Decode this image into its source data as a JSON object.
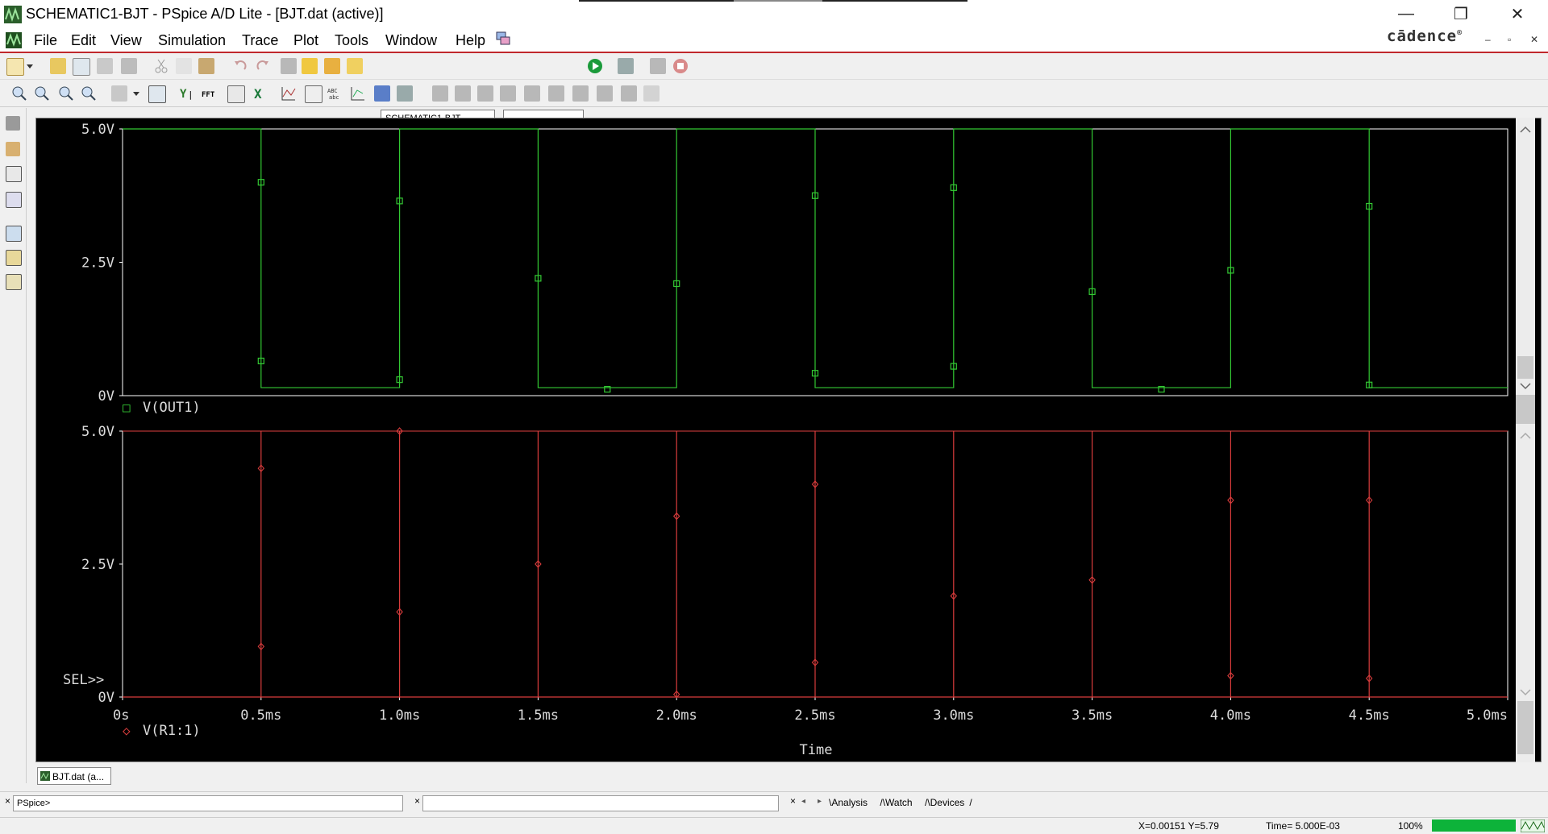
{
  "window": {
    "title": "SCHEMATIC1-BJT - PSpice A/D Lite - [BJT.dat (active)]",
    "controls": {
      "minimize": "—",
      "restore": "❐",
      "close": "✕"
    }
  },
  "menu": {
    "items": [
      "File",
      "Edit",
      "View",
      "Simulation",
      "Trace",
      "Plot",
      "Tools",
      "Window",
      "Help"
    ],
    "brand": "cādence",
    "brand_mark": "®",
    "mdi_controls": {
      "minimize": "–",
      "restore": "▫",
      "close": "✕"
    }
  },
  "toolbar": {
    "profile_value": "SCHEMATIC1-BJT",
    "second_combo_value": ""
  },
  "plot": {
    "upper": {
      "y_ticks": [
        "5.0V",
        "2.5V",
        "0V"
      ],
      "legend_marker": "□",
      "trace_label": "V(OUT1)",
      "color": "#33c933"
    },
    "lower": {
      "y_ticks": [
        "5.0V",
        "2.5V",
        "0V"
      ],
      "legend_marker": "◇",
      "trace_label": "V(R1:1)",
      "color": "#d93c3c",
      "sel_marker": "SEL>>"
    },
    "x_ticks": [
      "0s",
      "0.5ms",
      "1.0ms",
      "1.5ms",
      "2.0ms",
      "2.5ms",
      "3.0ms",
      "3.5ms",
      "4.0ms",
      "4.5ms",
      "5.0ms"
    ],
    "x_label": "Time",
    "background": "#000000",
    "grid_color": "#ffffff"
  },
  "chart_data": [
    {
      "type": "line",
      "series": [
        {
          "name": "V(OUT1)",
          "color": "#33c933"
        }
      ],
      "x": [
        0,
        0.5,
        0.5,
        1.0,
        1.0,
        1.5,
        1.5,
        2.0,
        2.0,
        2.5,
        2.5,
        3.0,
        3.0,
        3.5,
        3.5,
        4.0,
        4.0,
        4.5,
        4.5,
        5.0
      ],
      "values": [
        5.0,
        5.0,
        0.15,
        0.15,
        5.0,
        5.0,
        0.15,
        0.15,
        5.0,
        5.0,
        0.15,
        0.15,
        5.0,
        5.0,
        0.15,
        0.15,
        5.0,
        5.0,
        0.15,
        0.15
      ],
      "x_unit": "ms",
      "ylim": [
        0,
        5.0
      ],
      "xlim": [
        0,
        5.0
      ],
      "yticks": [
        "5.0V",
        "2.5V",
        "0V"
      ],
      "xlabel": "Time",
      "marker_points": [
        [
          0.5,
          4.0
        ],
        [
          0.5,
          0.65
        ],
        [
          1.0,
          3.65
        ],
        [
          1.0,
          0.3
        ],
        [
          1.5,
          2.2
        ],
        [
          1.75,
          0.12
        ],
        [
          2.0,
          2.1
        ],
        [
          2.5,
          3.75
        ],
        [
          2.5,
          0.42
        ],
        [
          3.0,
          3.9
        ],
        [
          3.0,
          0.55
        ],
        [
          3.5,
          1.95
        ],
        [
          3.75,
          0.12
        ],
        [
          4.0,
          2.35
        ],
        [
          4.5,
          3.55
        ],
        [
          4.5,
          0.2
        ]
      ]
    },
    {
      "type": "line",
      "series": [
        {
          "name": "V(R1:1)",
          "color": "#d93c3c"
        }
      ],
      "x": [
        0,
        0.5,
        0.5,
        0.5,
        1.0,
        1.0,
        1.0,
        1.5,
        1.5,
        1.5,
        2.0,
        2.0,
        2.0,
        2.5,
        2.5,
        2.5,
        3.0,
        3.0,
        3.0,
        3.5,
        3.5,
        3.5,
        4.0,
        4.0,
        4.0,
        4.5,
        4.5,
        4.5,
        5.0
      ],
      "values": [
        0,
        0,
        5.0,
        0,
        0,
        5.0,
        0,
        0,
        5.0,
        0,
        0,
        5.0,
        0,
        0,
        5.0,
        0,
        0,
        5.0,
        0,
        0,
        5.0,
        0,
        0,
        5.0,
        0,
        0,
        5.0,
        0,
        0
      ],
      "x_unit": "ms",
      "ylim": [
        0,
        5.0
      ],
      "xlim": [
        0,
        5.0
      ],
      "yticks": [
        "5.0V",
        "2.5V",
        "0V"
      ],
      "xlabel": "Time",
      "marker_points": [
        [
          0.5,
          4.3
        ],
        [
          0.5,
          0.95
        ],
        [
          1.0,
          5.0
        ],
        [
          1.0,
          1.6
        ],
        [
          1.5,
          2.5
        ],
        [
          2.0,
          3.4
        ],
        [
          2.0,
          0.05
        ],
        [
          2.5,
          4.0
        ],
        [
          2.5,
          0.65
        ],
        [
          3.0,
          1.9
        ],
        [
          3.5,
          2.2
        ],
        [
          4.0,
          3.7
        ],
        [
          4.0,
          0.4
        ],
        [
          4.5,
          3.7
        ],
        [
          4.5,
          0.35
        ]
      ]
    }
  ],
  "document_tab": {
    "label": "BJT.dat (a..."
  },
  "bottom": {
    "command_prompt": "PSpice>",
    "close_glyph": "×",
    "panel_tabs": [
      "Analysis",
      "Watch",
      "Devices"
    ]
  },
  "status": {
    "coords": "X=0.00151  Y=5.79",
    "time": "Time= 5.000E-03",
    "progress_label": "100%",
    "progress_fraction": 1.0
  }
}
